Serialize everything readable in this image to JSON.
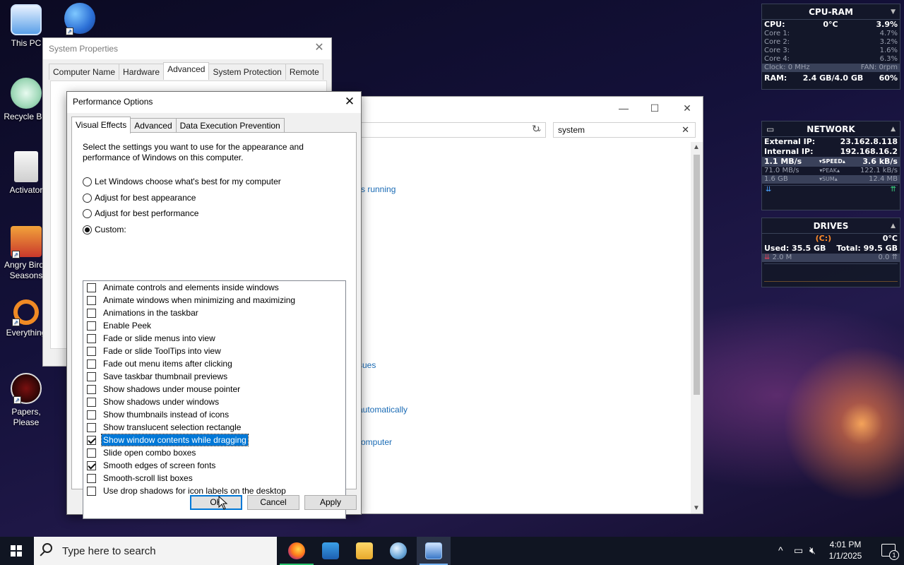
{
  "desktop": {
    "icons": [
      {
        "label": "This PC"
      },
      {
        "label": "Recycle Bin"
      },
      {
        "label": "Activator"
      },
      {
        "label": "Angry Birds Seasons"
      },
      {
        "label": "Everything"
      },
      {
        "label": "Papers, Please"
      }
    ]
  },
  "system_properties": {
    "title": "System Properties",
    "tabs": [
      "Computer Name",
      "Hardware",
      "Advanced",
      "System Protection",
      "Remote"
    ],
    "active_tab": "Advanced"
  },
  "control_panel": {
    "search_value": "system",
    "visible_links": [
      "r is running",
      "sues",
      "automatically",
      "omputer"
    ]
  },
  "performance_options": {
    "title": "Performance Options",
    "tabs": [
      "Visual Effects",
      "Advanced",
      "Data Execution Prevention"
    ],
    "active_tab": "Visual Effects",
    "description": "Select the settings you want to use for the appearance and performance of Windows on this computer.",
    "radios": [
      {
        "label": "Let Windows choose what's best for my computer",
        "checked": false
      },
      {
        "label": "Adjust for best appearance",
        "checked": false
      },
      {
        "label": "Adjust for best performance",
        "checked": false
      },
      {
        "label": "Custom:",
        "checked": true
      }
    ],
    "options": [
      {
        "label": "Animate controls and elements inside windows",
        "checked": false
      },
      {
        "label": "Animate windows when minimizing and maximizing",
        "checked": false
      },
      {
        "label": "Animations in the taskbar",
        "checked": false
      },
      {
        "label": "Enable Peek",
        "checked": false
      },
      {
        "label": "Fade or slide menus into view",
        "checked": false
      },
      {
        "label": "Fade or slide ToolTips into view",
        "checked": false
      },
      {
        "label": "Fade out menu items after clicking",
        "checked": false
      },
      {
        "label": "Save taskbar thumbnail previews",
        "checked": false
      },
      {
        "label": "Show shadows under mouse pointer",
        "checked": false
      },
      {
        "label": "Show shadows under windows",
        "checked": false
      },
      {
        "label": "Show thumbnails instead of icons",
        "checked": false
      },
      {
        "label": "Show translucent selection rectangle",
        "checked": false
      },
      {
        "label": "Show window contents while dragging",
        "checked": true,
        "selected": true
      },
      {
        "label": "Slide open combo boxes",
        "checked": false
      },
      {
        "label": "Smooth edges of screen fonts",
        "checked": true
      },
      {
        "label": "Smooth-scroll list boxes",
        "checked": false
      },
      {
        "label": "Use drop shadows for icon labels on the desktop",
        "checked": false
      }
    ],
    "buttons": {
      "ok": "OK",
      "cancel": "Cancel",
      "apply": "Apply"
    }
  },
  "gadgets": {
    "cpu_ram": {
      "title": "CPU-RAM",
      "cpu_label": "CPU:",
      "cpu_temp": "0°C",
      "cpu_pct": "3.9%",
      "cores": [
        {
          "label": "Core 1:",
          "value": "4.7%"
        },
        {
          "label": "Core 2:",
          "value": "3.2%"
        },
        {
          "label": "Core 3:",
          "value": "1.6%"
        },
        {
          "label": "Core 4:",
          "value": "6.3%"
        }
      ],
      "clock": "Clock: 0 MHz",
      "fan": "FAN: 0rpm",
      "ram_label": "RAM:",
      "ram_value": "2.4 GB/4.0 GB",
      "ram_pct": "60%"
    },
    "network": {
      "title": "NETWORK",
      "external_label": "External IP:",
      "external_ip": "23.162.8.118",
      "internal_label": "Internal IP:",
      "internal_ip": "192.168.16.2",
      "speed": {
        "left": "1.1 MB/s",
        "mid": "SPEED",
        "right": "3.6 kB/s"
      },
      "peak": {
        "left": "71.0 MB/s",
        "mid": "PEAK",
        "right": "122.1 kB/s"
      },
      "sum": {
        "left": "1.6 GB",
        "mid": "SUM",
        "right": "12.4 MB"
      }
    },
    "drives": {
      "title": "DRIVES",
      "drive_letter": "(C:)",
      "temp": "0°C",
      "used": "Used: 35.5 GB",
      "total": "Total: 99.5 GB",
      "read": "2.0 M",
      "write": "0.0"
    }
  },
  "taskbar": {
    "search_placeholder": "Type here to search",
    "time": "4:01 PM",
    "date": "1/1/2025",
    "notification_count": "1"
  }
}
